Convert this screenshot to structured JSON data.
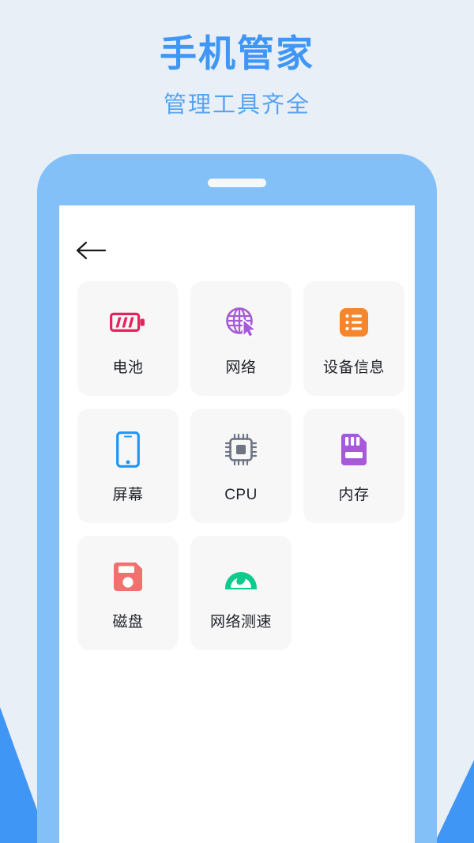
{
  "header": {
    "title": "手机管家",
    "subtitle": "管理工具齐全",
    "title_color": "#3f96f4",
    "subtitle_color": "#56a3f0"
  },
  "background": {
    "color": "#e9eff7",
    "accent_color": "#3f96f4"
  },
  "phone": {
    "frame_color": "#82c0f7",
    "screen_color": "#ffffff",
    "speaker_name": "speaker-grille"
  },
  "screen": {
    "back_button": {
      "icon": "arrow-left-icon",
      "color": "#1a1a1a"
    },
    "tiles": [
      {
        "label": "电池",
        "icon": "battery-icon",
        "color": "#e8225f"
      },
      {
        "label": "网络",
        "icon": "globe-cursor-icon",
        "color": "#a659d8"
      },
      {
        "label": "设备信息",
        "icon": "list-icon",
        "color": "#f5862e"
      },
      {
        "label": "屏幕",
        "icon": "smartphone-icon",
        "color": "#2196f3"
      },
      {
        "label": "CPU",
        "icon": "cpu-chip-icon",
        "color": "#6f7585"
      },
      {
        "label": "内存",
        "icon": "memory-card-icon",
        "color": "#a659d8"
      },
      {
        "label": "磁盘",
        "icon": "floppy-disk-icon",
        "color": "#f2706e"
      },
      {
        "label": "网络测速",
        "icon": "speedometer-icon",
        "color": "#0ecb8d"
      }
    ]
  }
}
